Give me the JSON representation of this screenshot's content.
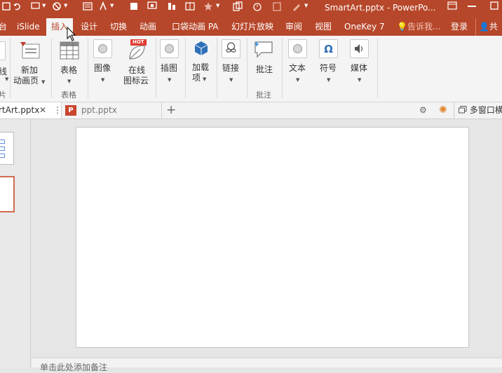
{
  "title_bar": {
    "title": "SmartArt.pptx - PowerPo...",
    "bg_color": "#b7472a"
  },
  "tabs": [
    {
      "label": "台",
      "active": false
    },
    {
      "label": "iSlide",
      "active": false
    },
    {
      "label": "插入",
      "active": true
    },
    {
      "label": "设计",
      "active": false
    },
    {
      "label": "切换",
      "active": false
    },
    {
      "label": "动画",
      "active": false
    },
    {
      "label": "口袋动画 PA",
      "active": false
    },
    {
      "label": "幻灯片放映",
      "active": false
    },
    {
      "label": "审阅",
      "active": false
    },
    {
      "label": "视图",
      "active": false
    },
    {
      "label": "OneKey 7",
      "active": false
    }
  ],
  "tell_me": {
    "placeholder": "告诉我..."
  },
  "signin": {
    "label": "登录"
  },
  "share": {
    "label": "共"
  },
  "ribbon": {
    "left_partial_label_1": "线",
    "left_partial_label_2": "片",
    "new_anim_page": {
      "line1": "新加",
      "line2": "动画页"
    },
    "table": {
      "label": "表格",
      "group": "表格"
    },
    "image": {
      "label": "图像"
    },
    "online_icons": {
      "line1": "在线",
      "line2": "图标云",
      "badge": "HOT"
    },
    "illustrations": {
      "label": "插图"
    },
    "addins": {
      "line1": "加载",
      "line2": "项"
    },
    "links": {
      "label": "链接"
    },
    "comment": {
      "label": "批注",
      "group": "批注"
    },
    "text": {
      "label": "文本"
    },
    "symbols": {
      "label": "符号"
    },
    "media": {
      "label": "媒体"
    }
  },
  "doc_tabs": [
    {
      "label": "rtArt.pptx",
      "active": true
    },
    {
      "label": "ppt.pptx",
      "active": false
    }
  ],
  "doc_tab_add": "+",
  "multi_window": {
    "label": "多窗口横"
  },
  "notes": {
    "placeholder": "单击此处添加备注"
  },
  "colors": {
    "accent": "#b7472a",
    "ribbon_bg": "#f4f4f4",
    "workspace_bg": "#e6e6e6"
  }
}
